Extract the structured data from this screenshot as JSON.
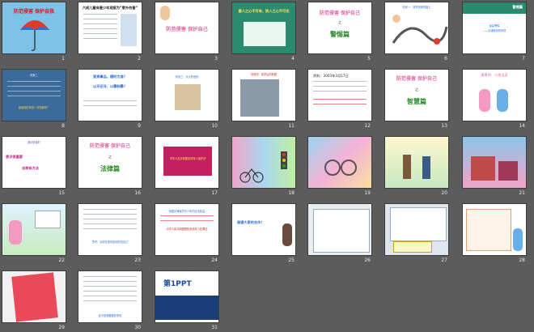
{
  "colors": {
    "background": "#5c5c5c",
    "number": "#e8e8e8"
  },
  "slides": [
    {
      "n": "1",
      "text": [
        "防范侵害 保护自我"
      ]
    },
    {
      "n": "2",
      "text": [
        "六成儿童有害少年观报为“意外伤害”"
      ]
    },
    {
      "n": "3",
      "text": [
        "防范侵害 保护自己"
      ]
    },
    {
      "n": "4",
      "text": [
        "害人之心不可有，防人之心不可无"
      ]
    },
    {
      "n": "5",
      "text": [
        "防范侵害 保护自己",
        "之",
        "警惕篇"
      ]
    },
    {
      "n": "6",
      "text": [
        "情景一：放学回家的路上"
      ]
    },
    {
      "n": "7",
      "text": [
        "警惕篇",
        "最高警惕",
        "——见诸危险的情境"
      ]
    },
    {
      "n": "8",
      "text": [
        "情景二",
        "最危险的事情？你知道吗？"
      ]
    },
    {
      "n": "9",
      "text": [
        "爱卖毒品，随时为准？",
        "以牙还牙，以暴制暴？"
      ]
    },
    {
      "n": "10",
      "text": [
        "情景三：大大的危险"
      ]
    },
    {
      "n": "11",
      "text": [
        "情景四：放学后的校园"
      ]
    },
    {
      "n": "12",
      "text": [
        "资料：2003年3月17日"
      ]
    },
    {
      "n": "13",
      "text": [
        "防范侵害 保护自己",
        "之",
        "智慧篇"
      ]
    },
    {
      "n": "14",
      "text": [
        "情景四：小鬼当家"
      ]
    },
    {
      "n": "15",
      "text": [
        "遇到侵害时",
        "意识很重要",
        "自救有方法"
      ]
    },
    {
      "n": "16",
      "text": [
        "防范侵害 保护自己",
        "之",
        "法律篇"
      ]
    },
    {
      "n": "17",
      "text": [
        "中华人民共和国未成年人保护法"
      ]
    },
    {
      "n": "18",
      "text": []
    },
    {
      "n": "19",
      "text": []
    },
    {
      "n": "20",
      "text": []
    },
    {
      "n": "21",
      "text": []
    },
    {
      "n": "22",
      "text": []
    },
    {
      "n": "23",
      "text": [
        "思考：请帮在家时如何防范自己"
      ]
    },
    {
      "n": "24",
      "text": [
        "我国法律保护青少年的合法权益",
        "中华人民共和国预防未成年人犯罪法"
      ]
    },
    {
      "n": "25",
      "text": [
        "谢谢大家的合作！"
      ]
    },
    {
      "n": "26",
      "text": []
    },
    {
      "n": "27",
      "text": []
    },
    {
      "n": "28",
      "text": []
    },
    {
      "n": "29",
      "text": []
    },
    {
      "n": "30",
      "text": [
        "这不是我要做的事情"
      ]
    },
    {
      "n": "31",
      "text": [
        "第1PPT"
      ]
    }
  ]
}
